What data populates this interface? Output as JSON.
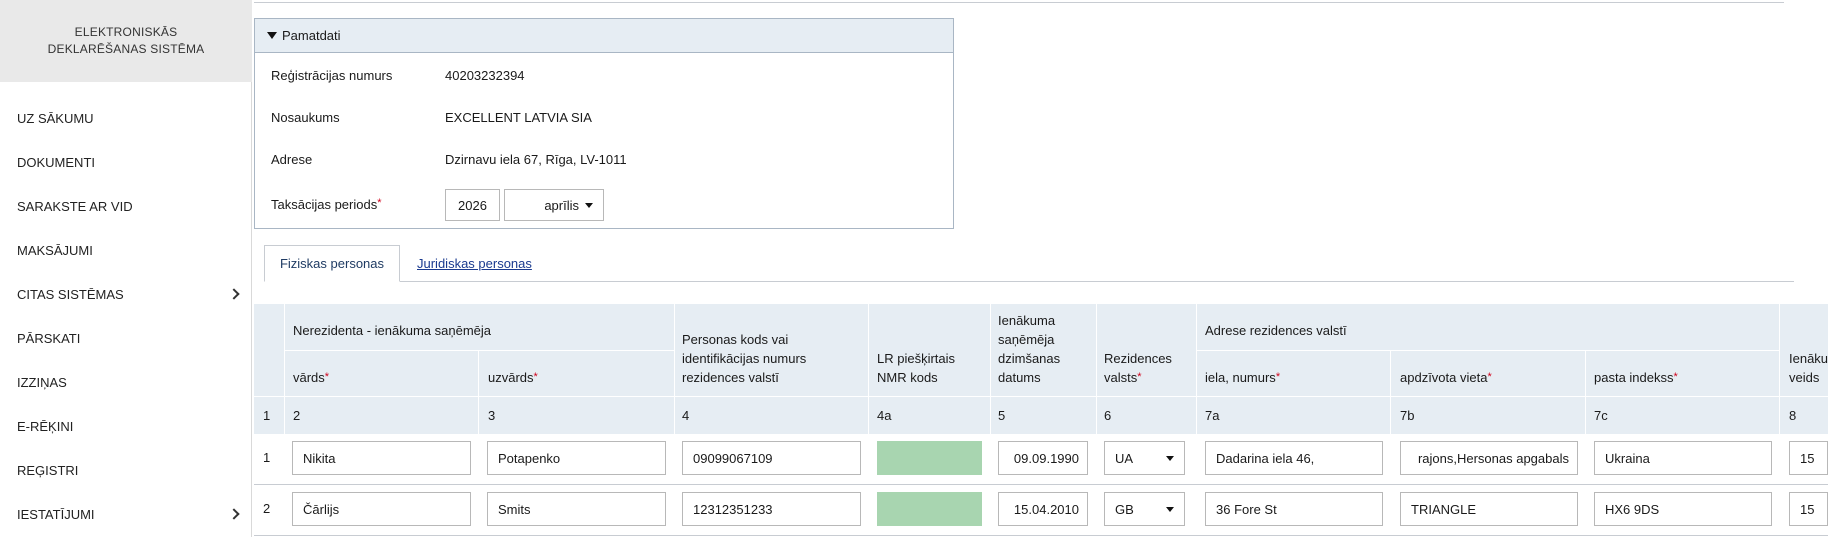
{
  "sidebar": {
    "header_line1": "ELEKTRONISKĀS",
    "header_line2": "DEKLARĒŠANAS SISTĒMA",
    "items": [
      {
        "label": "UZ SĀKUMU",
        "has_chevron": false
      },
      {
        "label": "DOKUMENTI",
        "has_chevron": false
      },
      {
        "label": "SARAKSTE AR VID",
        "has_chevron": false
      },
      {
        "label": "MAKSĀJUMI",
        "has_chevron": false
      },
      {
        "label": "CITAS SISTĒMAS",
        "has_chevron": true
      },
      {
        "label": "PĀRSKATI",
        "has_chevron": false
      },
      {
        "label": "IZZIŅAS",
        "has_chevron": false
      },
      {
        "label": "E-RĒĶINI",
        "has_chevron": false
      },
      {
        "label": "REĢISTRI",
        "has_chevron": false
      },
      {
        "label": "IESTATĪJUMI",
        "has_chevron": true
      }
    ]
  },
  "panel": {
    "title": "Pamatdati",
    "reg_label": "Reģistrācijas numurs",
    "reg_value": "40203232394",
    "name_label": "Nosaukums",
    "name_value": "EXCELLENT LATVIA SIA",
    "address_label": "Adrese",
    "address_value": "Dzirnavu iela 67, Rīga, LV-1011",
    "period_label": "Taksācijas periods",
    "period_year": "2026",
    "period_month": "aprīlis"
  },
  "tabs": {
    "active": "Fiziskas personas",
    "other": "Juridiskas personas"
  },
  "table": {
    "group_recipient": "Nerezidenta - ienākuma saņēmēja",
    "col_first": "vārds",
    "col_last": "uzvārds",
    "col_code_1": "Personas kods vai",
    "col_code_2": "identifikācijas numurs",
    "col_code_3": "rezidences valstī",
    "col_nmr_1": "LR piešķirtais",
    "col_nmr_2": "NMR kods",
    "col_dob_1": "Ienākuma",
    "col_dob_2": "saņēmēja",
    "col_dob_3": "dzimšanas",
    "col_dob_4": "datums",
    "col_country_1": "Rezidences",
    "col_country_2": "valsts",
    "group_address": "Adrese rezidences valstī",
    "col_street": "iela, numurs",
    "col_city": "apdzīvota vieta",
    "col_postal": "pasta indekss",
    "col_income_1": "Ienāku",
    "col_income_2": "veids",
    "numbers": [
      "1",
      "2",
      "3",
      "4",
      "4a",
      "5",
      "6",
      "7a",
      "7b",
      "7c",
      "8"
    ],
    "rows": [
      {
        "n": "1",
        "first": "Nikita",
        "last": "Potapenko",
        "code": "09099067109",
        "nmr": "",
        "dob": "09.09.1990",
        "country": "UA",
        "street": "Dadarina iela 46,",
        "city": "rajons,Hersonas apgabals",
        "postal": "Ukraina",
        "income": "15"
      },
      {
        "n": "2",
        "first": "Čārlijs",
        "last": "Smits",
        "code": "12312351233",
        "nmr": "",
        "dob": "15.04.2010",
        "country": "GB",
        "street": "36 Fore St",
        "city": "TRIANGLE",
        "postal": "HX6 9DS",
        "income": "15"
      }
    ]
  }
}
